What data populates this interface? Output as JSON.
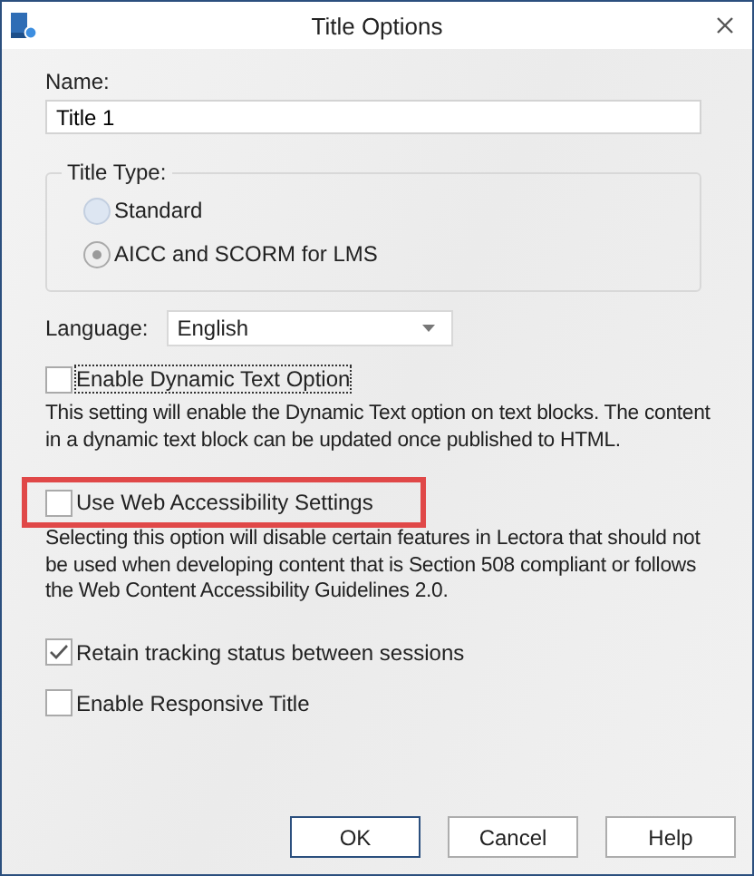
{
  "window": {
    "title": "Title Options"
  },
  "name_field": {
    "label": "Name:",
    "value": "Title 1"
  },
  "title_type": {
    "legend": "Title Type:",
    "options": [
      {
        "label": "Standard",
        "selected": false
      },
      {
        "label": "AICC and SCORM for LMS",
        "selected": true
      }
    ]
  },
  "language": {
    "label": "Language:",
    "value": "English"
  },
  "options": [
    {
      "label": "Enable Dynamic Text Option",
      "checked": false,
      "focused": true,
      "highlighted": false,
      "description": "This setting will enable the Dynamic Text option on text blocks. The content in a dynamic text block can be updated once published to HTML."
    },
    {
      "label": "Use Web Accessibility Settings",
      "checked": false,
      "focused": false,
      "highlighted": true,
      "description": "Selecting this option will disable certain features in Lectora that should not be used when developing content that is Section 508 compliant or follows the Web Content Accessibility Guidelines 2.0."
    },
    {
      "label": "Retain tracking status between sessions",
      "checked": true,
      "focused": false,
      "highlighted": false
    },
    {
      "label": "Enable Responsive Title",
      "checked": false,
      "focused": false,
      "highlighted": false
    }
  ],
  "buttons": [
    {
      "label": "OK",
      "default": true
    },
    {
      "label": "Cancel",
      "default": false
    },
    {
      "label": "Help",
      "default": false
    }
  ]
}
